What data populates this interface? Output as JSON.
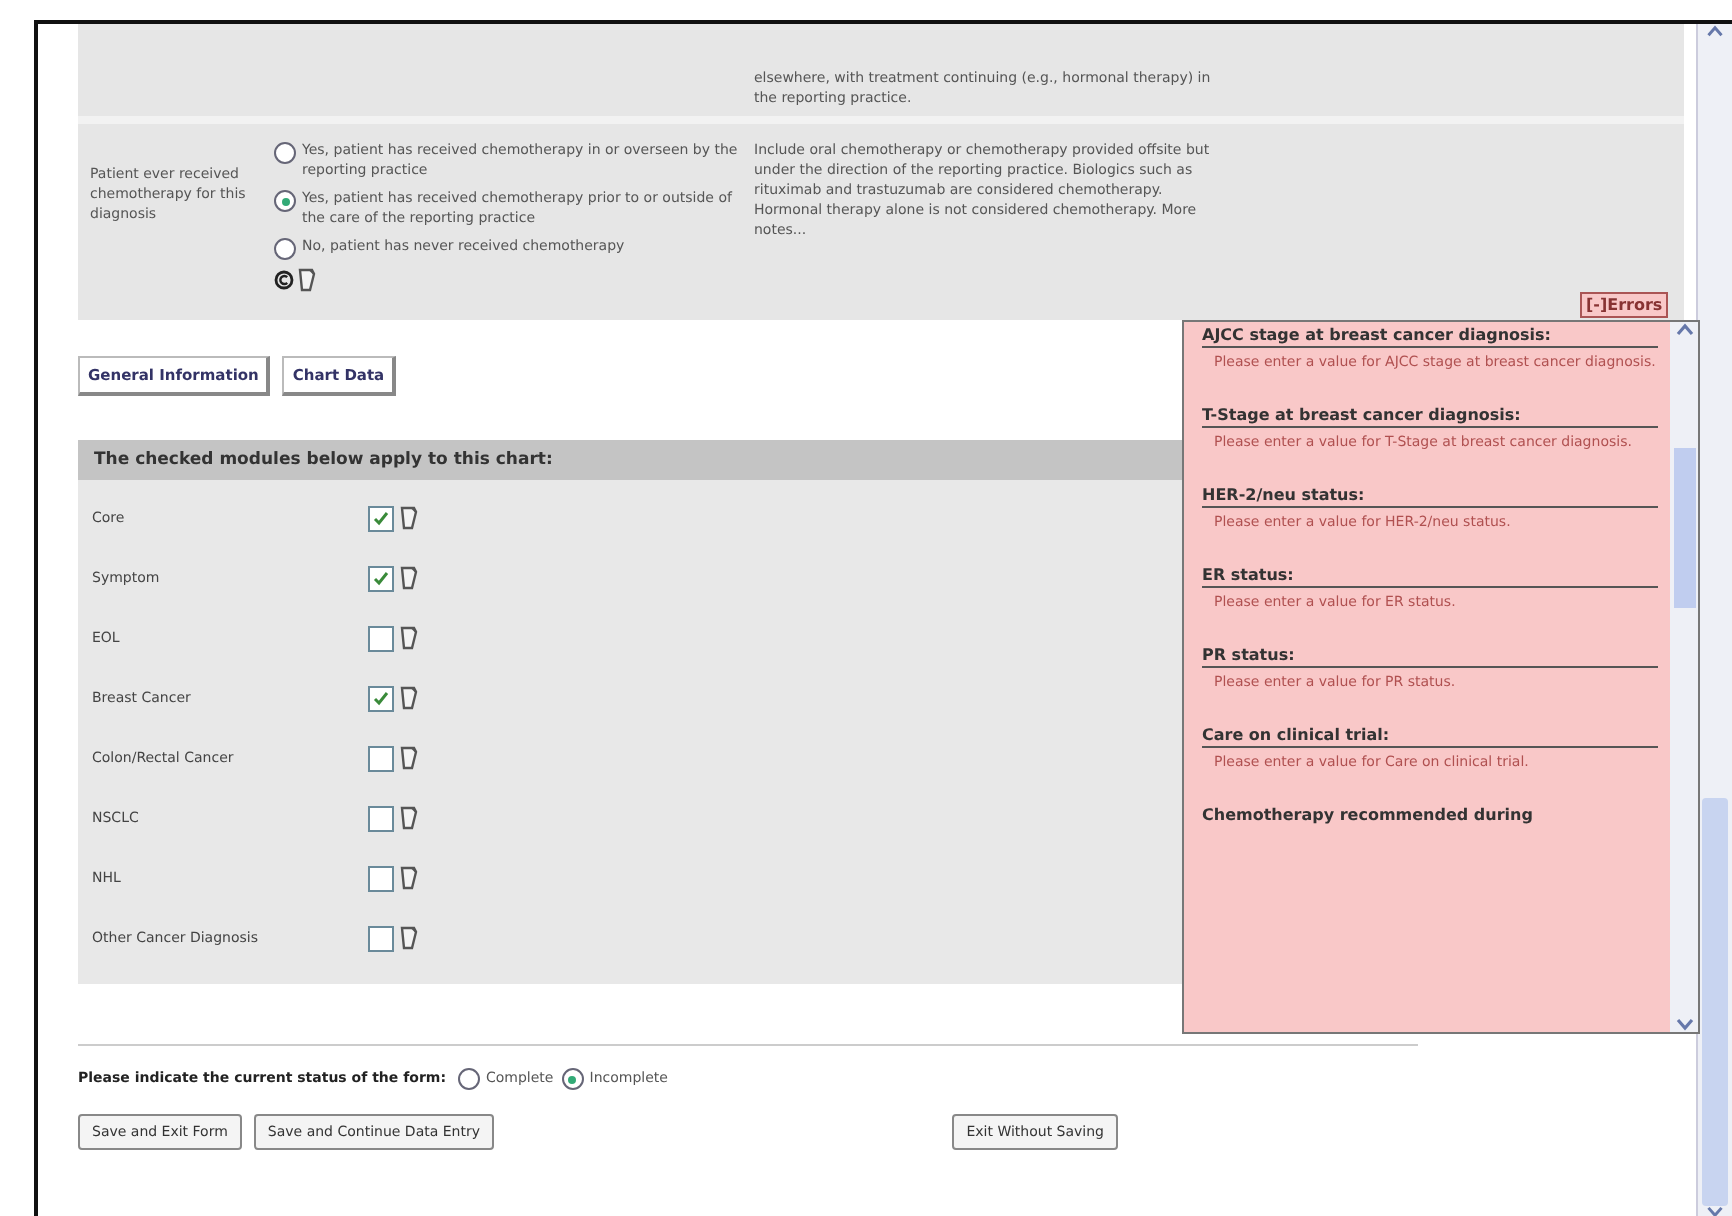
{
  "previous_note": "elsewhere, with treatment continuing (e.g., hormonal therapy) in the reporting practice.",
  "question": {
    "label": "Patient ever received chemotherapy for this diagnosis",
    "note": "Include oral chemotherapy or chemotherapy provided offsite but under the direction of the reporting practice. Biologics such as rituximab and trastuzumab are considered chemotherapy. Hormonal therapy alone is not considered chemotherapy. More notes...",
    "options": [
      {
        "text": "Yes, patient has received chemotherapy in or overseen by the reporting practice",
        "selected": false
      },
      {
        "text": "Yes, patient has received chemotherapy prior to or outside of the care of the reporting practice",
        "selected": true
      },
      {
        "text": "No, patient has never received chemotherapy",
        "selected": false
      }
    ]
  },
  "tabs": [
    {
      "label": "General Information"
    },
    {
      "label": "Chart Data"
    }
  ],
  "modules": {
    "heading": "The checked modules below apply to this chart:",
    "items": [
      {
        "name": "Core",
        "checked": true
      },
      {
        "name": "Symptom",
        "checked": true
      },
      {
        "name": "EOL",
        "checked": false
      },
      {
        "name": "Breast Cancer",
        "checked": true
      },
      {
        "name": "Colon/Rectal Cancer",
        "checked": false
      },
      {
        "name": "NSCLC",
        "checked": false
      },
      {
        "name": "NHL",
        "checked": false
      },
      {
        "name": "Other Cancer Diagnosis",
        "checked": false
      }
    ]
  },
  "status": {
    "label": "Please indicate the current status of the form:",
    "options": [
      {
        "text": "Complete",
        "selected": false
      },
      {
        "text": "Incomplete",
        "selected": true
      }
    ]
  },
  "buttons": [
    {
      "label": "Save and Exit Form"
    },
    {
      "label": "Save and Continue Data Entry"
    }
  ],
  "exit_button": "Exit Without Saving",
  "errors": {
    "toggle": "[-]Errors",
    "items": [
      {
        "field": "AJCC stage at breast cancer diagnosis:",
        "message": "Please enter a value for AJCC stage at breast cancer diagnosis."
      },
      {
        "field": "T-Stage at breast cancer diagnosis:",
        "message": "Please enter a value for T-Stage at breast cancer diagnosis."
      },
      {
        "field": "HER-2/neu status:",
        "message": "Please enter a value for HER-2/neu status."
      },
      {
        "field": "ER status:",
        "message": "Please enter a value for ER status."
      },
      {
        "field": "PR status:",
        "message": "Please enter a value for PR status."
      },
      {
        "field": "Care on clinical trial:",
        "message": "Please enter a value for Care on clinical trial."
      },
      {
        "field": "Chemotherapy recommended during"
      }
    ]
  }
}
